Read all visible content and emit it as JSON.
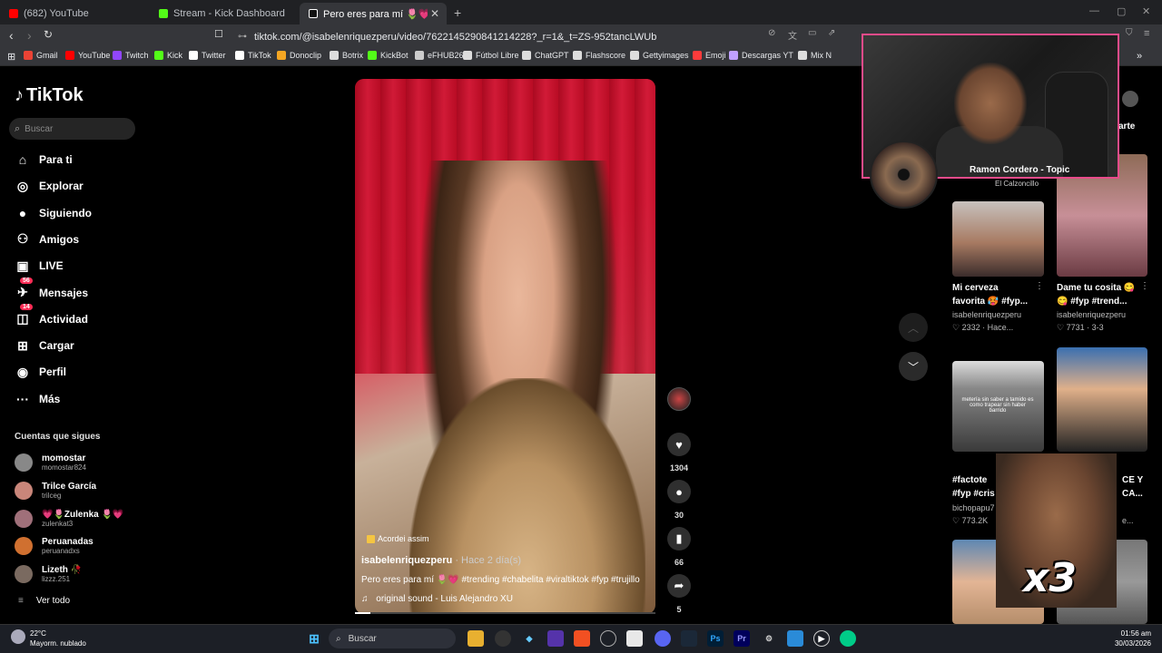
{
  "browser": {
    "tabs": [
      {
        "label": "(682) YouTube",
        "color": "#ff0000"
      },
      {
        "label": "Stream - Kick Dashboard",
        "color": "#53fc18"
      },
      {
        "label": "Pero eres para mí 🌷💗 #trendin",
        "color": "#ffffff"
      }
    ],
    "url": "tiktok.com/@isabelenriquezperu/video/7622145290841214228?_r=1&_t=ZS-952tancLWUb",
    "bookmarks": [
      {
        "label": "Gmail",
        "color": "#ea4335"
      },
      {
        "label": "YouTube",
        "color": "#ff0000"
      },
      {
        "label": "Twitch",
        "color": "#9146ff"
      },
      {
        "label": "Kick",
        "color": "#53fc18"
      },
      {
        "label": "Twitter",
        "color": "#ffffff"
      },
      {
        "label": "TikTok",
        "color": "#ffffff"
      },
      {
        "label": "Donoclip",
        "color": "#f5a623"
      },
      {
        "label": "Botrix",
        "color": "#dddddd"
      },
      {
        "label": "KickBot",
        "color": "#53fc18"
      },
      {
        "label": "eFHUB26",
        "color": "#cccccc"
      },
      {
        "label": "Fútbol Libre",
        "color": "#dddddd"
      },
      {
        "label": "ChatGPT",
        "color": "#dddddd"
      },
      {
        "label": "Flashscore",
        "color": "#dddddd"
      },
      {
        "label": "Gettyimages",
        "color": "#dddddd"
      },
      {
        "label": "Emoji",
        "color": "#ff3b3b"
      },
      {
        "label": "Descargas YT",
        "color": "#c0a0ff"
      },
      {
        "label": "Mix N",
        "color": "#dddddd"
      }
    ]
  },
  "sidebar": {
    "logo": "TikTok",
    "search_placeholder": "Buscar",
    "nav": [
      {
        "label": "Para ti",
        "icon": "home-icon"
      },
      {
        "label": "Explorar",
        "icon": "compass-icon"
      },
      {
        "label": "Siguiendo",
        "icon": "following-icon"
      },
      {
        "label": "Amigos",
        "icon": "friends-icon"
      },
      {
        "label": "LIVE",
        "icon": "live-icon"
      },
      {
        "label": "Mensajes",
        "icon": "messages-icon",
        "badge": "56"
      },
      {
        "label": "Actividad",
        "icon": "activity-icon",
        "badge": "14"
      },
      {
        "label": "Cargar",
        "icon": "upload-icon"
      },
      {
        "label": "Perfil",
        "icon": "profile-icon"
      },
      {
        "label": "Más",
        "icon": "more-icon"
      }
    ],
    "following_title": "Cuentas que sigues",
    "accounts": [
      {
        "name": "momostar",
        "handle": "momostar824",
        "color": "#888888"
      },
      {
        "name": "Trilce García",
        "handle": "trilceg",
        "color": "#c9867a"
      },
      {
        "name": "💗🌷Zulenka 🌷💗",
        "handle": "zulenkat3",
        "color": "#a0707a"
      },
      {
        "name": "Peruanadas",
        "handle": "peruanadxs",
        "color": "#d07030"
      },
      {
        "name": "Lizeth 🥀",
        "handle": "lizzz.251",
        "color": "#7a6a60"
      }
    ],
    "see_all": "Ver todo"
  },
  "video": {
    "tag": "Acordei assim",
    "username": "isabelenriquezperu",
    "time_ago": "· Hace 2 día(s)",
    "caption": "Pero eres para mí 🌷💗 #trending #chabelita #viraltiktok #fyp #trujillo",
    "sound": "original sound - Luis Alejandro XU",
    "progress": 0.05,
    "likes": "1304",
    "comments": "30",
    "saves": "66",
    "shares": "5"
  },
  "overlay": {
    "music_title": "Ramon Cordero - Topic",
    "music_sub": "El Calzoncillo",
    "meme_text": "x3"
  },
  "right_panel": {
    "share_tab": "arte",
    "cards": [
      {
        "title1": "Mi cerveza",
        "title2": "favorita 🥵 #fyp...",
        "user": "isabelenriquezperu",
        "stats": "♡ 2332 · Hace..."
      },
      {
        "title1": "Dame tu cosita 😋",
        "title2": "😋 #fyp #trend...",
        "user": "isabelenriquezperu",
        "stats": "♡ 7731 · 3-3"
      },
      {
        "title1": "#factote",
        "title2": "#fyp #cris",
        "user": "bichopapu7",
        "stats": "♡ 773.2K"
      },
      {
        "title1": "CE Y",
        "title2": "CA...",
        "user": "",
        "stats": "e..."
      }
    ],
    "thumb_text": "metería sin saber a tamido es como trapear sin haber barrido"
  },
  "taskbar": {
    "temp": "22°C",
    "weather": "Mayorm. nublado",
    "search": "Buscar",
    "time": "01:56 am",
    "date": "30/03/2026"
  }
}
